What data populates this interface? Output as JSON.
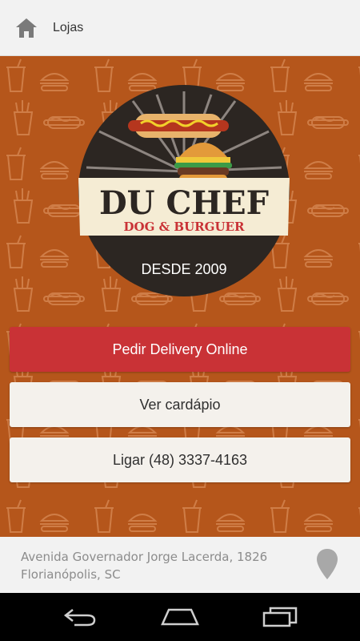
{
  "topbar": {
    "title": "Lojas",
    "home_icon": "home-icon"
  },
  "logo": {
    "name": "DU CHEF",
    "tagline": "DOG & BURGUER",
    "since": "DESDE 2009"
  },
  "actions": {
    "delivery_label": "Pedir Delivery Online",
    "menu_label": "Ver cardápio",
    "call_label": "Ligar (48) 3337-4163"
  },
  "footer": {
    "address_line1": "Avenida Governador Jorge Lacerda, 1826",
    "address_line2": "Florianópolis, SC",
    "pin_icon": "location-pin-icon"
  },
  "navbar": {
    "icons": [
      "back-icon",
      "home-nav-icon",
      "recent-apps-icon"
    ]
  },
  "colors": {
    "brand_orange": "#b5561b",
    "delivery_red": "#c93236",
    "button_light": "#f4f1ec",
    "logo_cream": "#f5ecd4",
    "logo_dark": "#2c2622"
  }
}
